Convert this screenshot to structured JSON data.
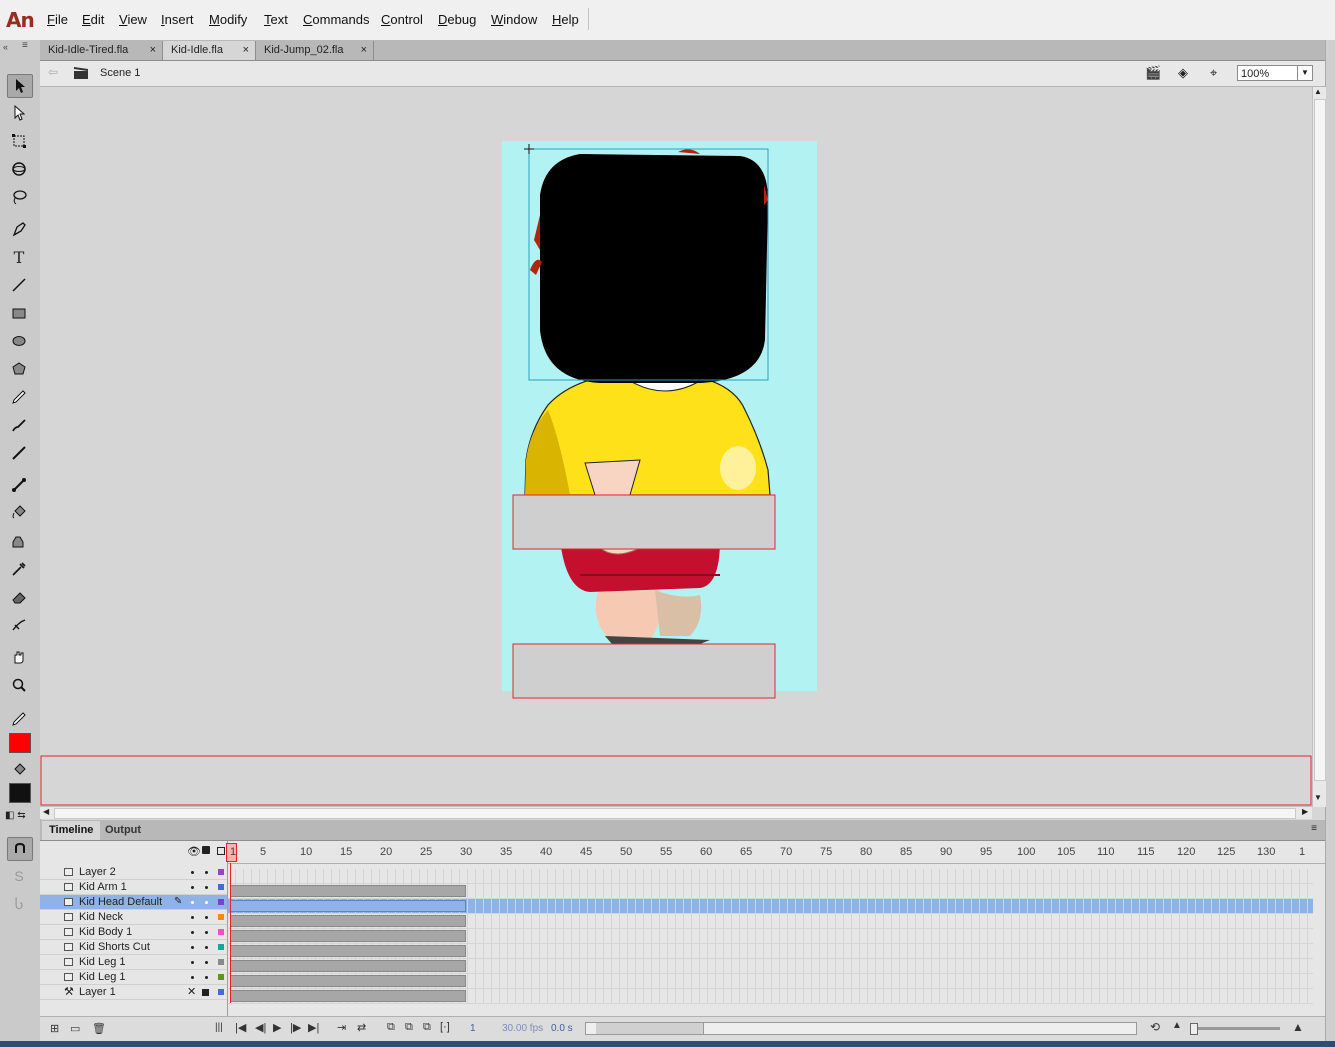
{
  "app": {
    "logo": "An"
  },
  "menu": [
    "File",
    "Edit",
    "View",
    "Insert",
    "Modify",
    "Text",
    "Commands",
    "Control",
    "Debug",
    "Window",
    "Help"
  ],
  "doc_tabs": [
    {
      "label": "Kid-Idle-Tired.fla",
      "close": "×",
      "active": false
    },
    {
      "label": "Kid-Idle.fla",
      "close": "×",
      "active": true
    },
    {
      "label": "Kid-Jump_02.fla",
      "close": "×",
      "active": false
    }
  ],
  "editbar": {
    "scene": "Scene 1",
    "zoom": "100%"
  },
  "timeline_tabs": [
    "Timeline",
    "Output"
  ],
  "layers": [
    {
      "name": "Layer 2",
      "color": "#9b3fd3"
    },
    {
      "name": "Kid Arm 1",
      "color": "#3f6be0"
    },
    {
      "name": "Kid Head Default",
      "color": "#7b3fd3",
      "selected": true
    },
    {
      "name": "Kid Neck",
      "color": "#f08a1a"
    },
    {
      "name": "Kid Body 1",
      "color": "#f04dd3"
    },
    {
      "name": "Kid Shorts Cut",
      "color": "#12a89a"
    },
    {
      "name": "Kid Leg 1",
      "color": "#8a8a8a"
    },
    {
      "name": "Kid Leg 1",
      "color": "#5a9a1a"
    },
    {
      "name": "Layer 1",
      "color": "#3f6be0",
      "guide": true
    }
  ],
  "ruler_ticks": [
    "1",
    "5",
    "10",
    "15",
    "20",
    "25",
    "30",
    "35",
    "40",
    "45",
    "50",
    "55",
    "60",
    "65",
    "70",
    "75",
    "80",
    "85",
    "90",
    "95",
    "100",
    "105",
    "110",
    "115",
    "120",
    "125",
    "130",
    "1"
  ],
  "status": {
    "frame": "1",
    "fps": "30.00 fps",
    "time": "0.0 s"
  },
  "colors": {
    "stroke": "#ff0000",
    "fill": "#111111",
    "stage": "#b3f2f2",
    "selection": "#8fb3e6"
  },
  "icons": [
    "selection-tool-icon",
    "subselection-tool-icon",
    "free-transform-icon",
    "3d-rotation-icon",
    "lasso-icon",
    "pen-icon",
    "text-tool-icon",
    "line-tool-icon",
    "rectangle-tool-icon",
    "oval-tool-icon",
    "polystar-icon",
    "pencil-icon",
    "paint-brush-icon",
    "brush-icon",
    "bone-icon",
    "paint-bucket-icon",
    "ink-bottle-icon",
    "eyedropper-icon",
    "eraser-icon",
    "width-tool-icon",
    "hand-tool-icon",
    "zoom-tool-icon"
  ]
}
